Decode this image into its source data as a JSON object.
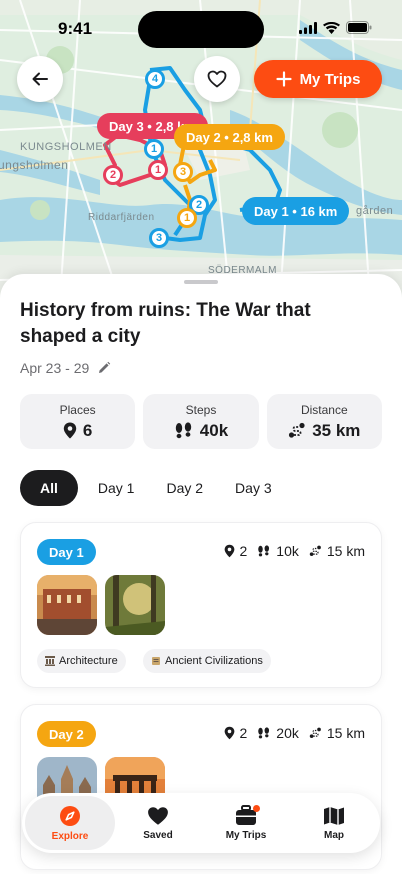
{
  "status": {
    "time": "9:41"
  },
  "map": {
    "labels": [
      "KUNGSHOLMEN",
      "ungsholmen",
      "Riddarfjärden",
      "gården",
      "SÖDERMALM"
    ],
    "route_labels": [
      {
        "text": "Day 3 • 2,8 km",
        "color": "#e63e5c"
      },
      {
        "text": "Day 2 • 2,8 km",
        "color": "#f5a611"
      },
      {
        "text": "Day 1 • 16 km",
        "color": "#1a9fe3"
      }
    ],
    "stops": [
      {
        "n": "4",
        "color": "#1a9fe3"
      },
      {
        "n": "1",
        "color": "#1a9fe3"
      },
      {
        "n": "2",
        "color": "#e63e5c"
      },
      {
        "n": "1",
        "color": "#e63e5c"
      },
      {
        "n": "3",
        "color": "#f5a611"
      },
      {
        "n": "2",
        "color": "#1a9fe3"
      },
      {
        "n": "1",
        "color": "#f5a611"
      },
      {
        "n": "3",
        "color": "#1a9fe3"
      }
    ]
  },
  "header": {
    "my_trips_label": "My Trips"
  },
  "trip": {
    "title": "History from ruins: The War that shaped a city",
    "dates": "Apr 23 - 29"
  },
  "stats": [
    {
      "label": "Places",
      "value": "6",
      "icon": "pin-icon"
    },
    {
      "label": "Steps",
      "value": "40k",
      "icon": "footsteps-icon"
    },
    {
      "label": "Distance",
      "value": "35 km",
      "icon": "route-icon"
    }
  ],
  "tabs": [
    "All",
    "Day 1",
    "Day 2",
    "Day 3"
  ],
  "days": [
    {
      "label": "Day 1",
      "color": "#1a9fe3",
      "places": "2",
      "steps": "10k",
      "distance": "15 km",
      "tags": [
        "Architecture",
        "Ancient Civilizations"
      ]
    },
    {
      "label": "Day 2",
      "color": "#f5a611",
      "places": "2",
      "steps": "20k",
      "distance": "15 km",
      "tags": []
    }
  ],
  "nav": [
    "Explore",
    "Saved",
    "My Trips",
    "Map"
  ],
  "colors": {
    "accent": "#fd4c12",
    "day1": "#1a9fe3",
    "day2": "#f5a611",
    "day3": "#e63e5c"
  }
}
